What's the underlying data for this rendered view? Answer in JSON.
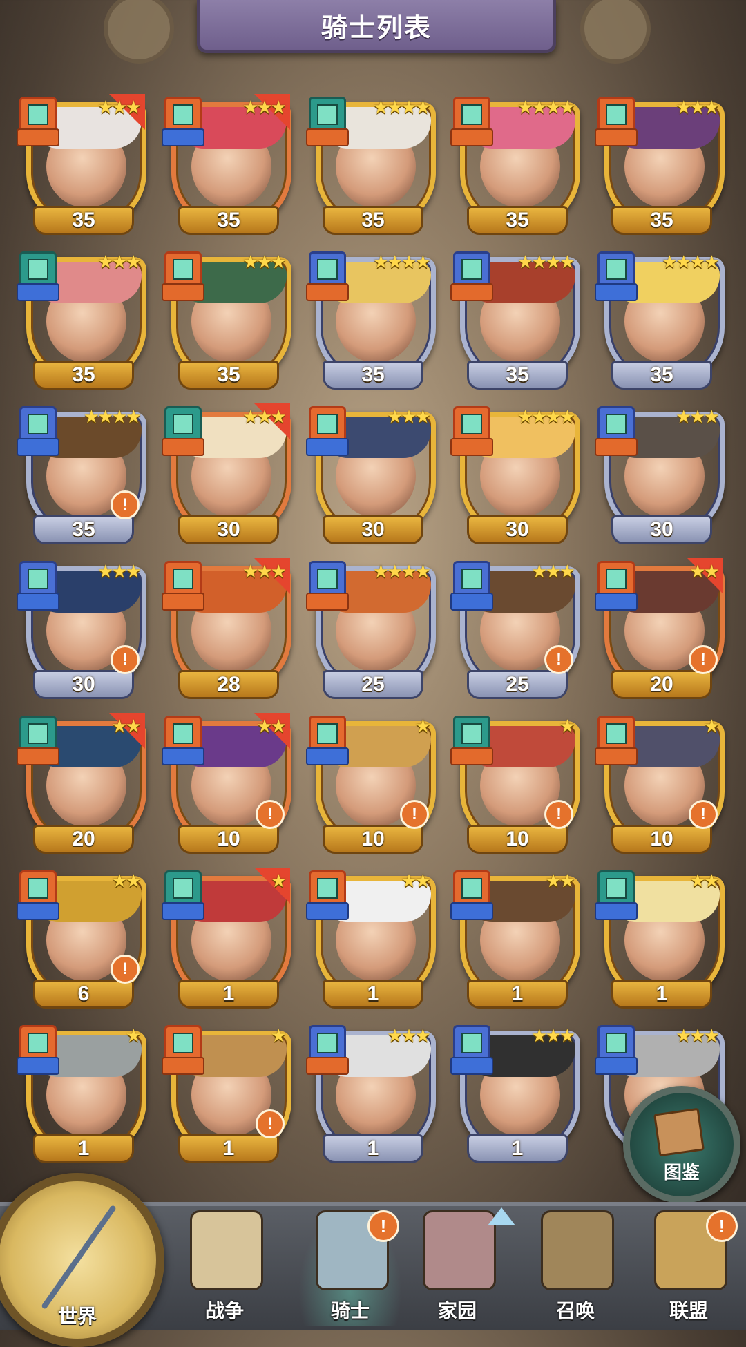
{
  "header": {
    "title": "骑士列表"
  },
  "knights": [
    {
      "level": "35",
      "stars": "★★★",
      "frame": "gold",
      "corner": true,
      "alert": false,
      "role": "orange"
    },
    {
      "level": "35",
      "stars": "★★★",
      "frame": "red",
      "corner": true,
      "alert": false,
      "role": "blue"
    },
    {
      "level": "35",
      "stars": "★★★★",
      "frame": "gold",
      "corner": false,
      "alert": false,
      "role": "orange"
    },
    {
      "level": "35",
      "stars": "★★★★",
      "frame": "gold",
      "corner": false,
      "alert": false,
      "role": "orange"
    },
    {
      "level": "35",
      "stars": "★★★",
      "frame": "gold",
      "corner": false,
      "alert": false,
      "role": "orange"
    },
    {
      "level": "35",
      "stars": "★★★",
      "frame": "gold",
      "corner": false,
      "alert": false,
      "role": "blue"
    },
    {
      "level": "35",
      "stars": "★★★",
      "frame": "gold",
      "corner": false,
      "alert": false,
      "role": "orange"
    },
    {
      "level": "35",
      "stars": "★★★★",
      "frame": "blue",
      "corner": false,
      "alert": false,
      "role": "orange"
    },
    {
      "level": "35",
      "stars": "★★★★",
      "frame": "blue",
      "corner": false,
      "alert": false,
      "role": "orange"
    },
    {
      "level": "35",
      "stars": "★★★★",
      "frame": "blue",
      "corner": false,
      "alert": false,
      "role": "blue"
    },
    {
      "level": "35",
      "stars": "★★★★",
      "frame": "blue",
      "corner": false,
      "alert": true,
      "role": "blue"
    },
    {
      "level": "30",
      "stars": "★★★",
      "frame": "red",
      "corner": true,
      "alert": false,
      "role": "orange"
    },
    {
      "level": "30",
      "stars": "★★★",
      "frame": "gold",
      "corner": false,
      "alert": false,
      "role": "blue"
    },
    {
      "level": "30",
      "stars": "★★★★",
      "frame": "gold",
      "corner": false,
      "alert": false,
      "role": "orange"
    },
    {
      "level": "30",
      "stars": "★★★",
      "frame": "blue",
      "corner": false,
      "alert": false,
      "role": "orange"
    },
    {
      "level": "30",
      "stars": "★★★",
      "frame": "blue",
      "corner": false,
      "alert": true,
      "role": "blue"
    },
    {
      "level": "28",
      "stars": "★★★",
      "frame": "red",
      "corner": true,
      "alert": false,
      "role": "orange"
    },
    {
      "level": "25",
      "stars": "★★★★",
      "frame": "blue",
      "corner": false,
      "alert": false,
      "role": "orange"
    },
    {
      "level": "25",
      "stars": "★★★",
      "frame": "blue",
      "corner": false,
      "alert": true,
      "role": "blue"
    },
    {
      "level": "20",
      "stars": "★★",
      "frame": "red",
      "corner": true,
      "alert": true,
      "role": "blue"
    },
    {
      "level": "20",
      "stars": "★★",
      "frame": "red",
      "corner": true,
      "alert": false,
      "role": "orange"
    },
    {
      "level": "10",
      "stars": "★★",
      "frame": "red",
      "corner": true,
      "alert": true,
      "role": "blue"
    },
    {
      "level": "10",
      "stars": "★",
      "frame": "gold",
      "corner": false,
      "alert": true,
      "role": "blue"
    },
    {
      "level": "10",
      "stars": "★",
      "frame": "gold",
      "corner": false,
      "alert": true,
      "role": "orange"
    },
    {
      "level": "10",
      "stars": "★",
      "frame": "gold",
      "corner": false,
      "alert": true,
      "role": "orange"
    },
    {
      "level": "6",
      "stars": "★★",
      "frame": "gold",
      "corner": false,
      "alert": true,
      "role": "blue"
    },
    {
      "level": "1",
      "stars": "★",
      "frame": "red",
      "corner": true,
      "alert": false,
      "role": "blue"
    },
    {
      "level": "1",
      "stars": "★★",
      "frame": "gold",
      "corner": false,
      "alert": false,
      "role": "blue"
    },
    {
      "level": "1",
      "stars": "★★",
      "frame": "gold",
      "corner": false,
      "alert": false,
      "role": "blue"
    },
    {
      "level": "1",
      "stars": "★★",
      "frame": "gold",
      "corner": false,
      "alert": false,
      "role": "blue"
    },
    {
      "level": "1",
      "stars": "★",
      "frame": "gold",
      "corner": false,
      "alert": false,
      "role": "blue"
    },
    {
      "level": "1",
      "stars": "★",
      "frame": "gold",
      "corner": false,
      "alert": true,
      "role": "orange"
    },
    {
      "level": "1",
      "stars": "★★★",
      "frame": "blue",
      "corner": false,
      "alert": false,
      "role": "orange"
    },
    {
      "level": "1",
      "stars": "★★★",
      "frame": "blue",
      "corner": false,
      "alert": false,
      "role": "blue"
    },
    {
      "level": "",
      "stars": "★★★",
      "frame": "blue",
      "corner": false,
      "alert": false,
      "role": "blue"
    }
  ],
  "codex": {
    "label": "图鉴"
  },
  "nav": {
    "world": "世界",
    "war": "战争",
    "knight": "骑士",
    "home": "家园",
    "summon": "召唤",
    "alliance": "联盟",
    "alert_mark": "!"
  },
  "colors": {
    "accent_gold": "#e8b53a",
    "accent_blue": "#aab3cf",
    "alert": "#e5722c"
  }
}
